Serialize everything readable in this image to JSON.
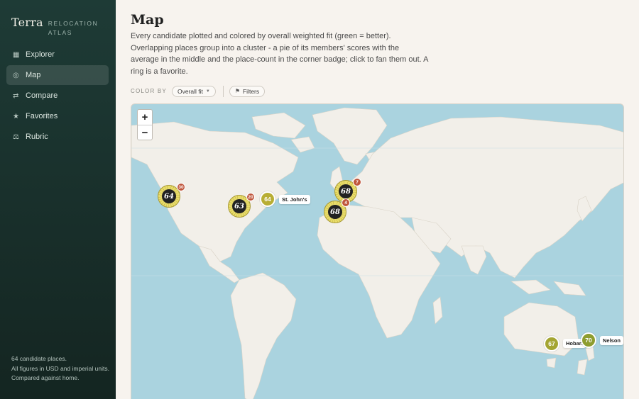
{
  "brand": {
    "name": "Terra",
    "sub_line1": "RELOCATION",
    "sub_line2": "ATLAS"
  },
  "nav": [
    {
      "icon": "grid-icon",
      "glyph": "▦",
      "label": "Explorer",
      "active": false
    },
    {
      "icon": "target-icon",
      "glyph": "◎",
      "label": "Map",
      "active": true
    },
    {
      "icon": "swap-icon",
      "glyph": "⇄",
      "label": "Compare",
      "active": false
    },
    {
      "icon": "star-icon",
      "glyph": "★",
      "label": "Favorites",
      "active": false
    },
    {
      "icon": "scale-icon",
      "glyph": "⚖",
      "label": "Rubric",
      "active": false
    }
  ],
  "footer": {
    "line1": "64 candidate places.",
    "line2": "All figures in USD and imperial units.",
    "line3": "Compared against home."
  },
  "page": {
    "title": "Map",
    "description": "Every candidate plotted and colored by overall weighted fit (green = better). Overlapping places group into a cluster - a pie of its members' scores with the average in the middle and the place-count in the corner badge; click to fan them out. A ring is a favorite."
  },
  "controls": {
    "color_by_label": "COLOR BY",
    "color_by_value": "Overall fit",
    "filters_label": "Filters"
  },
  "map": {
    "zoom_in": "+",
    "zoom_out": "−",
    "clusters": [
      {
        "id": "us-west",
        "average": "64",
        "count": "30"
      },
      {
        "id": "us-east",
        "average": "63",
        "count": "20"
      },
      {
        "id": "north-europe",
        "average": "68",
        "count": "7"
      },
      {
        "id": "south-europe",
        "average": "68",
        "count": "4"
      }
    ],
    "places": [
      {
        "id": "st-johns",
        "score": "64",
        "label": "St. John's",
        "color": "#b8ae34"
      },
      {
        "id": "hobart",
        "score": "67",
        "label": "Hobart",
        "color": "#a4a532"
      },
      {
        "id": "nelson",
        "score": "70",
        "label": "Nelson",
        "color": "#8e9d2f"
      }
    ]
  }
}
